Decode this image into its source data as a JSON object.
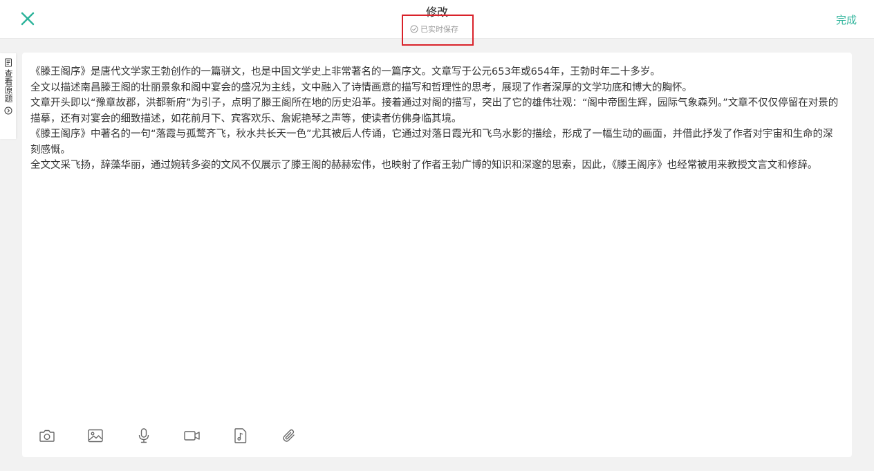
{
  "header": {
    "title": "修改",
    "save_status": "已实时保存",
    "done_label": "完成",
    "accent_color": "#2cb39a"
  },
  "side_tab": {
    "label": "查看原题"
  },
  "editor": {
    "paragraphs": [
      "《滕王阁序》是唐代文学家王勃创作的一篇骈文，也是中国文学史上非常著名的一篇序文。文章写于公元653年或654年，王勃时年二十多岁。",
      "全文以描述南昌滕王阁的壮丽景象和阁中宴会的盛况为主线，文中融入了诗情画意的描写和哲理性的思考，展现了作者深厚的文学功底和博大的胸怀。",
      "文章开头即以“豫章故郡，洪都新府”为引子，点明了滕王阁所在地的历史沿革。接着通过对阁的描写，突出了它的雄伟壮观：“阁中帝图生辉，园际气象森列。”文章不仅仅停留在对景的描摹，还有对宴会的细致描述，如花前月下、宾客欢乐、詹妮艳琴之声等，使读者仿佛身临其境。",
      "《滕王阁序》中著名的一句“落霞与孤鹜齐飞，秋水共长天一色”尤其被后人传诵，它通过对落日霞光和飞鸟水影的描绘，形成了一幅生动的画面，并借此抒发了作者对宇宙和生命的深刻感慨。",
      "全文文采飞扬，辞藻华丽，通过婉转多姿的文风不仅展示了滕王阁的赫赫宏伟，也映射了作者王勃广博的知识和深邃的思索，因此，《滕王阁序》也经常被用来教授文言文和修辞。"
    ]
  },
  "toolbar": {
    "icons": [
      "camera-icon",
      "image-icon",
      "microphone-icon",
      "video-icon",
      "audio-file-icon",
      "attachment-icon"
    ]
  }
}
